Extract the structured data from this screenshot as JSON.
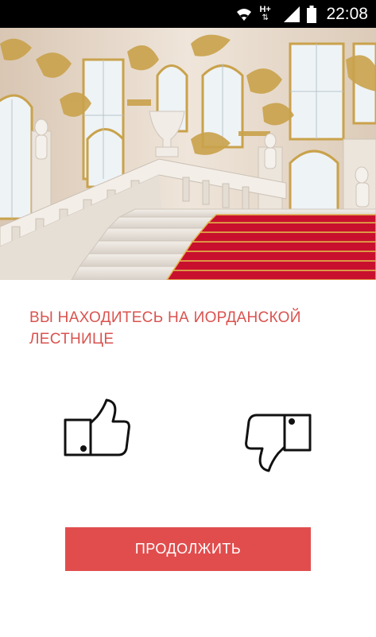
{
  "status_bar": {
    "time": "22:08",
    "network_label": "H+",
    "icons": [
      "wifi-icon",
      "mobile-data-icon",
      "signal-icon",
      "battery-icon"
    ]
  },
  "location": {
    "title": "ВЫ НАХОДИТЕСЬ НА  ИОРДАНСКОЙ ЛЕСТНИЦЕ"
  },
  "feedback": {
    "like_icon": "thumbs-up-icon",
    "dislike_icon": "thumbs-down-icon"
  },
  "continue_button": {
    "label": "ПРОДОЛЖИТЬ"
  },
  "colors": {
    "accent": "#e14d4d",
    "title_text": "#d9534f",
    "status_bar": "#000000",
    "carpet": "#c8102e",
    "gold": "#c9a24b"
  }
}
